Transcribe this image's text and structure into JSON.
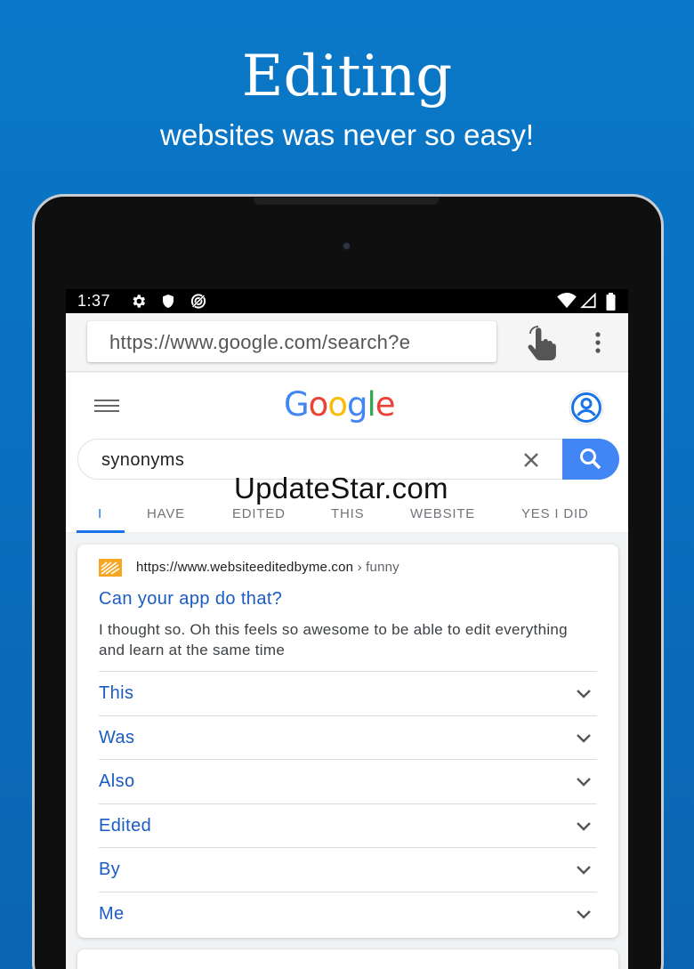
{
  "promo": {
    "title": "Editing",
    "subtitle": "websites was never so easy!"
  },
  "status_bar": {
    "time": "1:37",
    "icons": [
      "gear-icon",
      "shield-icon",
      "hotspot-icon",
      "wifi-icon",
      "signal-icon",
      "battery-icon"
    ]
  },
  "browser": {
    "url": "https://www.google.com/search?e",
    "touch_icon": "hand-pointer-icon",
    "menu_icon": "overflow-menu-icon"
  },
  "google": {
    "logo_letters": [
      "G",
      "o",
      "o",
      "g",
      "l",
      "e"
    ],
    "logo_colors": [
      "#4285f4",
      "#ea4335",
      "#fbbc05",
      "#4285f4",
      "#34a853",
      "#ea4335"
    ],
    "search_query": "synonyms",
    "tabs": [
      {
        "label": "I",
        "active": true
      },
      {
        "label": "HAVE",
        "active": false
      },
      {
        "label": "EDITED",
        "active": false
      },
      {
        "label": "THIS",
        "active": false
      },
      {
        "label": "WEBSITE",
        "active": false
      },
      {
        "label": "YES I DID",
        "active": false
      }
    ]
  },
  "watermark": "UpdateStar.com",
  "result": {
    "site": "https://www.websiteeditedbyme.con",
    "crumb": " › funny",
    "title": "Can your app do that?",
    "snippet": "I thought so. Oh this feels so awesome to be able to edit everything and learn at the same time",
    "items": [
      "This",
      "Was",
      "Also",
      "Edited",
      "By",
      "Me"
    ]
  },
  "colors": {
    "accent_blue": "#1a73e8",
    "link_blue": "#1a5bc4",
    "search_button": "#4285f4"
  }
}
